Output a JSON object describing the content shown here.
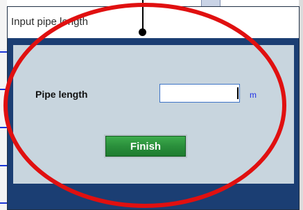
{
  "dialog": {
    "title": "Input pipe length"
  },
  "form": {
    "pipe_length_label": "Pipe length",
    "pipe_length_value": "",
    "unit": "m",
    "finish_label": "Finish"
  },
  "colors": {
    "dialog_frame": "#1b3e73",
    "content_background": "#c8d5de",
    "input_border": "#3d73c6",
    "unit_text": "#1e2ee6",
    "button_green": "#2a8f3b",
    "annotation_red": "#e01010"
  }
}
